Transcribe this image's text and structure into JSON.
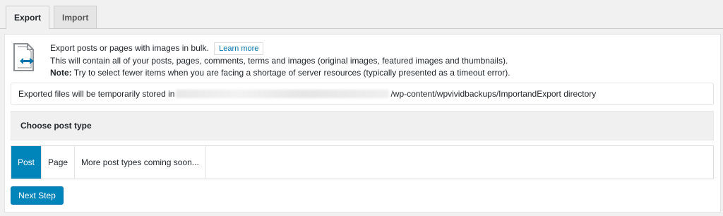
{
  "tabs": [
    {
      "label": "Export",
      "active": true
    },
    {
      "label": "Import",
      "active": false
    }
  ],
  "intro": {
    "icon": "export-document-arrows-icon",
    "line1": "Export posts or pages with images in bulk.",
    "learn_more": "Learn more",
    "line2": "This will contain all of your posts, pages, comments, terms and images (original images, featured images and thumbnails).",
    "note_label": "Note:",
    "note_text": " Try to select fewer items when you are facing a shortage of server resources (typically presented as a timeout error)."
  },
  "storage": {
    "prefix": "Exported files will be temporarily stored in ",
    "suffix": "/wp-content/wpvividbackups/ImportandExport directory"
  },
  "choose_post_type": {
    "title": "Choose post type"
  },
  "post_types": [
    {
      "label": "Post",
      "selected": true
    },
    {
      "label": "Page",
      "selected": false
    },
    {
      "label": "More post types coming soon...",
      "selected": false
    }
  ],
  "next_step": "Next Step",
  "colors": {
    "accent": "#0085ba",
    "link": "#0073aa",
    "icon_arrows": "#0073aa",
    "icon_page": "#8c8f94"
  }
}
